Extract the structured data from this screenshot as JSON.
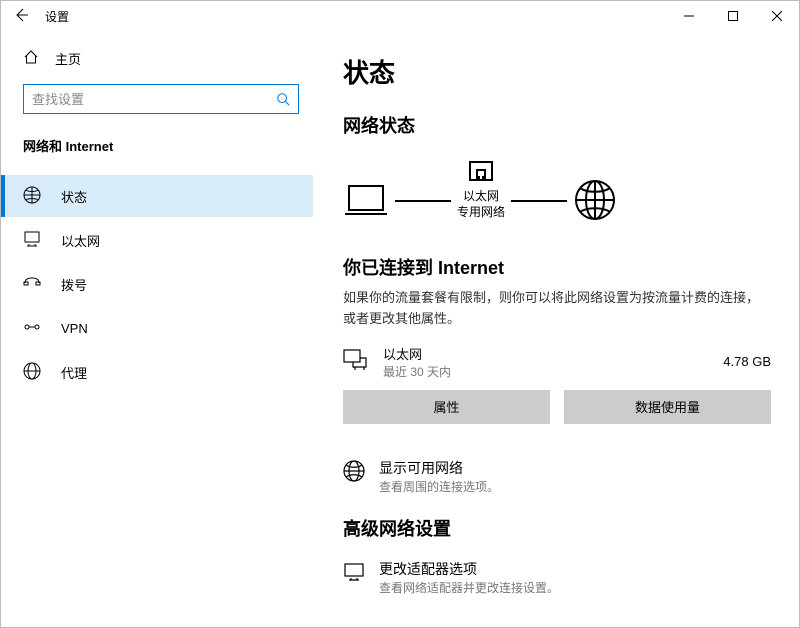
{
  "titlebar": {
    "title": "设置"
  },
  "sidebar": {
    "home": "主页",
    "search_placeholder": "查找设置",
    "category": "网络和 Internet",
    "items": [
      {
        "label": "状态"
      },
      {
        "label": "以太网"
      },
      {
        "label": "拨号"
      },
      {
        "label": "VPN"
      },
      {
        "label": "代理"
      }
    ]
  },
  "content": {
    "page_title": "状态",
    "network_status_heading": "网络状态",
    "diagram": {
      "conn_label": "以太网",
      "conn_sub": "专用网络"
    },
    "connected_heading": "你已连接到 Internet",
    "connected_desc": "如果你的流量套餐有限制，则你可以将此网络设置为按流量计费的连接，或者更改其他属性。",
    "conn": {
      "name": "以太网",
      "sub": "最近 30 天内",
      "usage": "4.78 GB"
    },
    "btn_properties": "属性",
    "btn_data_usage": "数据使用量",
    "avail": {
      "title": "显示可用网络",
      "sub": "查看周围的连接选项。"
    },
    "adv_heading": "高级网络设置",
    "adapter": {
      "title": "更改适配器选项",
      "sub": "查看网络适配器并更改连接设置。"
    }
  }
}
